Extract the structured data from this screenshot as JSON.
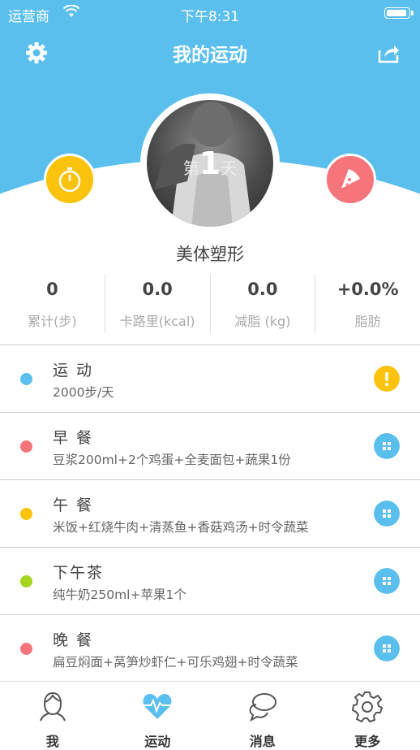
{
  "status_bar": {
    "carrier": "运营商",
    "time": "下午8:31",
    "battery_level": 1.0
  },
  "header": {
    "title": "我的运动",
    "left_icon": "gear-icon",
    "right_icon": "share-icon"
  },
  "profile": {
    "day_prefix": "第",
    "day_number": "1",
    "day_suffix": "天",
    "name": "美体塑形",
    "left_icon": "stopwatch-icon",
    "right_icon": "pizza-icon"
  },
  "stats": [
    {
      "value": "0",
      "label": "累计(步)"
    },
    {
      "value": "0.0",
      "label": "卡路里(kcal)"
    },
    {
      "value": "0.0",
      "label": "减脂 (kg)"
    },
    {
      "value": "+0.0%",
      "label": "脂肪"
    }
  ],
  "plan": [
    {
      "title": "运 动",
      "detail": "2000步/天",
      "dot_color": "#5bbfee",
      "action_icon": "alert-icon",
      "action_color": "#fcc30c"
    },
    {
      "title": "早 餐",
      "detail": "豆浆200ml+2个鸡蛋+全麦面包+蔬果1份",
      "dot_color": "#f5757a",
      "action_icon": "grid-icon",
      "action_color": "#5bbfee"
    },
    {
      "title": "午 餐",
      "detail": "米饭+红烧牛肉+清蒸鱼+香菇鸡汤+时令蔬菜",
      "dot_color": "#fcc30c",
      "action_icon": "grid-icon",
      "action_color": "#5bbfee"
    },
    {
      "title": "下午茶",
      "detail": "纯牛奶250ml+苹果1个",
      "dot_color": "#a3d61c",
      "action_icon": "grid-icon",
      "action_color": "#5bbfee"
    },
    {
      "title": "晚 餐",
      "detail": "扁豆焖面+莴笋炒虾仁+可乐鸡翅+时令蔬菜",
      "dot_color": "#f5757a",
      "action_icon": "grid-icon",
      "action_color": "#5bbfee"
    }
  ],
  "tabs": [
    {
      "label": "我",
      "icon": "person-icon"
    },
    {
      "label": "运动",
      "icon": "heart-pulse-icon",
      "active": true
    },
    {
      "label": "消息",
      "icon": "chat-icon"
    },
    {
      "label": "更多",
      "icon": "gear-icon"
    }
  ]
}
